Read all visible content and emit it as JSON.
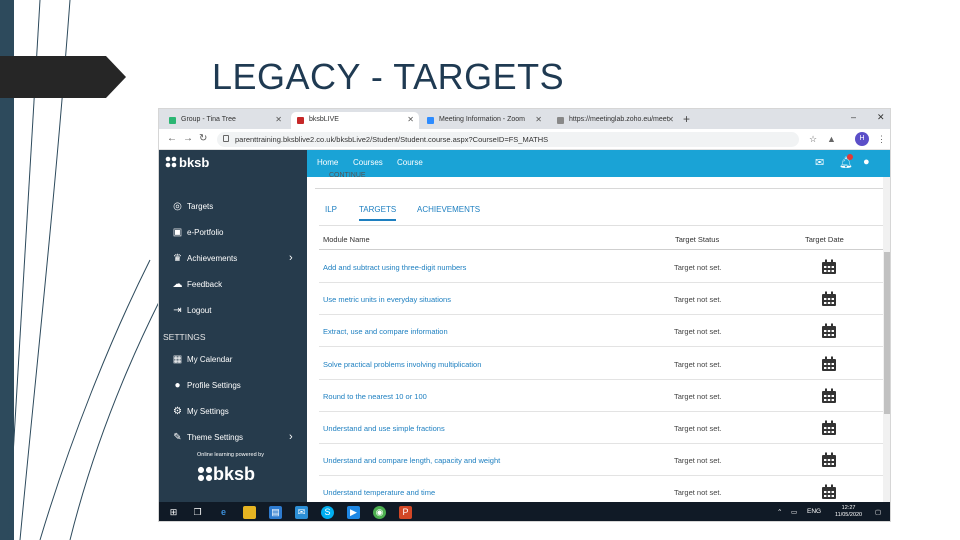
{
  "slide": {
    "title": "LEGACY - TARGETS"
  },
  "browser": {
    "tabs": [
      {
        "label": "Group - Tina Tree",
        "color": "#2bb673"
      },
      {
        "label": "bksbLIVE",
        "color": "#c62828"
      },
      {
        "label": "Meeting Information - Zoom",
        "color": "#2d8cff"
      },
      {
        "label": "https://meetinglab.zoho.eu/meet",
        "color": "#888888"
      }
    ],
    "new_tab": "+",
    "url": "parenttraining.bksblive2.co.uk/bksbLive2/Student/Student.course.aspx?CourseID=FS_MATHS",
    "avatar_initial": "H"
  },
  "app": {
    "brand": "bksb",
    "nav": [
      "Home",
      "Courses",
      "Course"
    ],
    "sidebar": {
      "items": [
        {
          "label": "Targets",
          "icon": "target-icon"
        },
        {
          "label": "e-Portfolio",
          "icon": "briefcase-icon"
        },
        {
          "label": "Achievements",
          "icon": "trophy-icon",
          "chevron": true
        },
        {
          "label": "Feedback",
          "icon": "chat-icon"
        },
        {
          "label": "Logout",
          "icon": "logout-icon"
        }
      ],
      "settings_heading": "SETTINGS",
      "settings_items": [
        {
          "label": "My Calendar",
          "icon": "calendar-icon"
        },
        {
          "label": "Profile Settings",
          "icon": "user-icon"
        },
        {
          "label": "My Settings",
          "icon": "gear-icon"
        },
        {
          "label": "Theme Settings",
          "icon": "brush-icon",
          "chevron": true
        }
      ],
      "powered_by": "Online learning powered by",
      "powered_logo": "bksb"
    },
    "main": {
      "continue_label": "CONTINUE",
      "tabs": [
        "ILP",
        "TARGETS",
        "ACHIEVEMENTS"
      ],
      "active_tab": "TARGETS",
      "columns": [
        "Module Name",
        "Target Status",
        "Target Date"
      ],
      "rows": [
        {
          "name": "Add and subtract using three-digit numbers",
          "status": "Target not set."
        },
        {
          "name": "Use metric units in everyday situations",
          "status": "Target not set."
        },
        {
          "name": "Extract, use and compare information",
          "status": "Target not set."
        },
        {
          "name": "Solve practical problems involving multiplication",
          "status": "Target not set."
        },
        {
          "name": "Round to the nearest 10 or 100",
          "status": "Target not set."
        },
        {
          "name": "Understand and use simple fractions",
          "status": "Target not set."
        },
        {
          "name": "Understand and compare length, capacity and weight",
          "status": "Target not set."
        },
        {
          "name": "Understand temperature and time",
          "status": "Target not set."
        }
      ]
    }
  },
  "taskbar": {
    "time": "12:27",
    "date": "11/05/2020",
    "lang": "ENG"
  },
  "colors": {
    "header_blue": "#1aa3d6",
    "sidebar_navy": "#263b4c",
    "link_blue": "#1d7fc0",
    "title_navy": "#1f3a52"
  }
}
